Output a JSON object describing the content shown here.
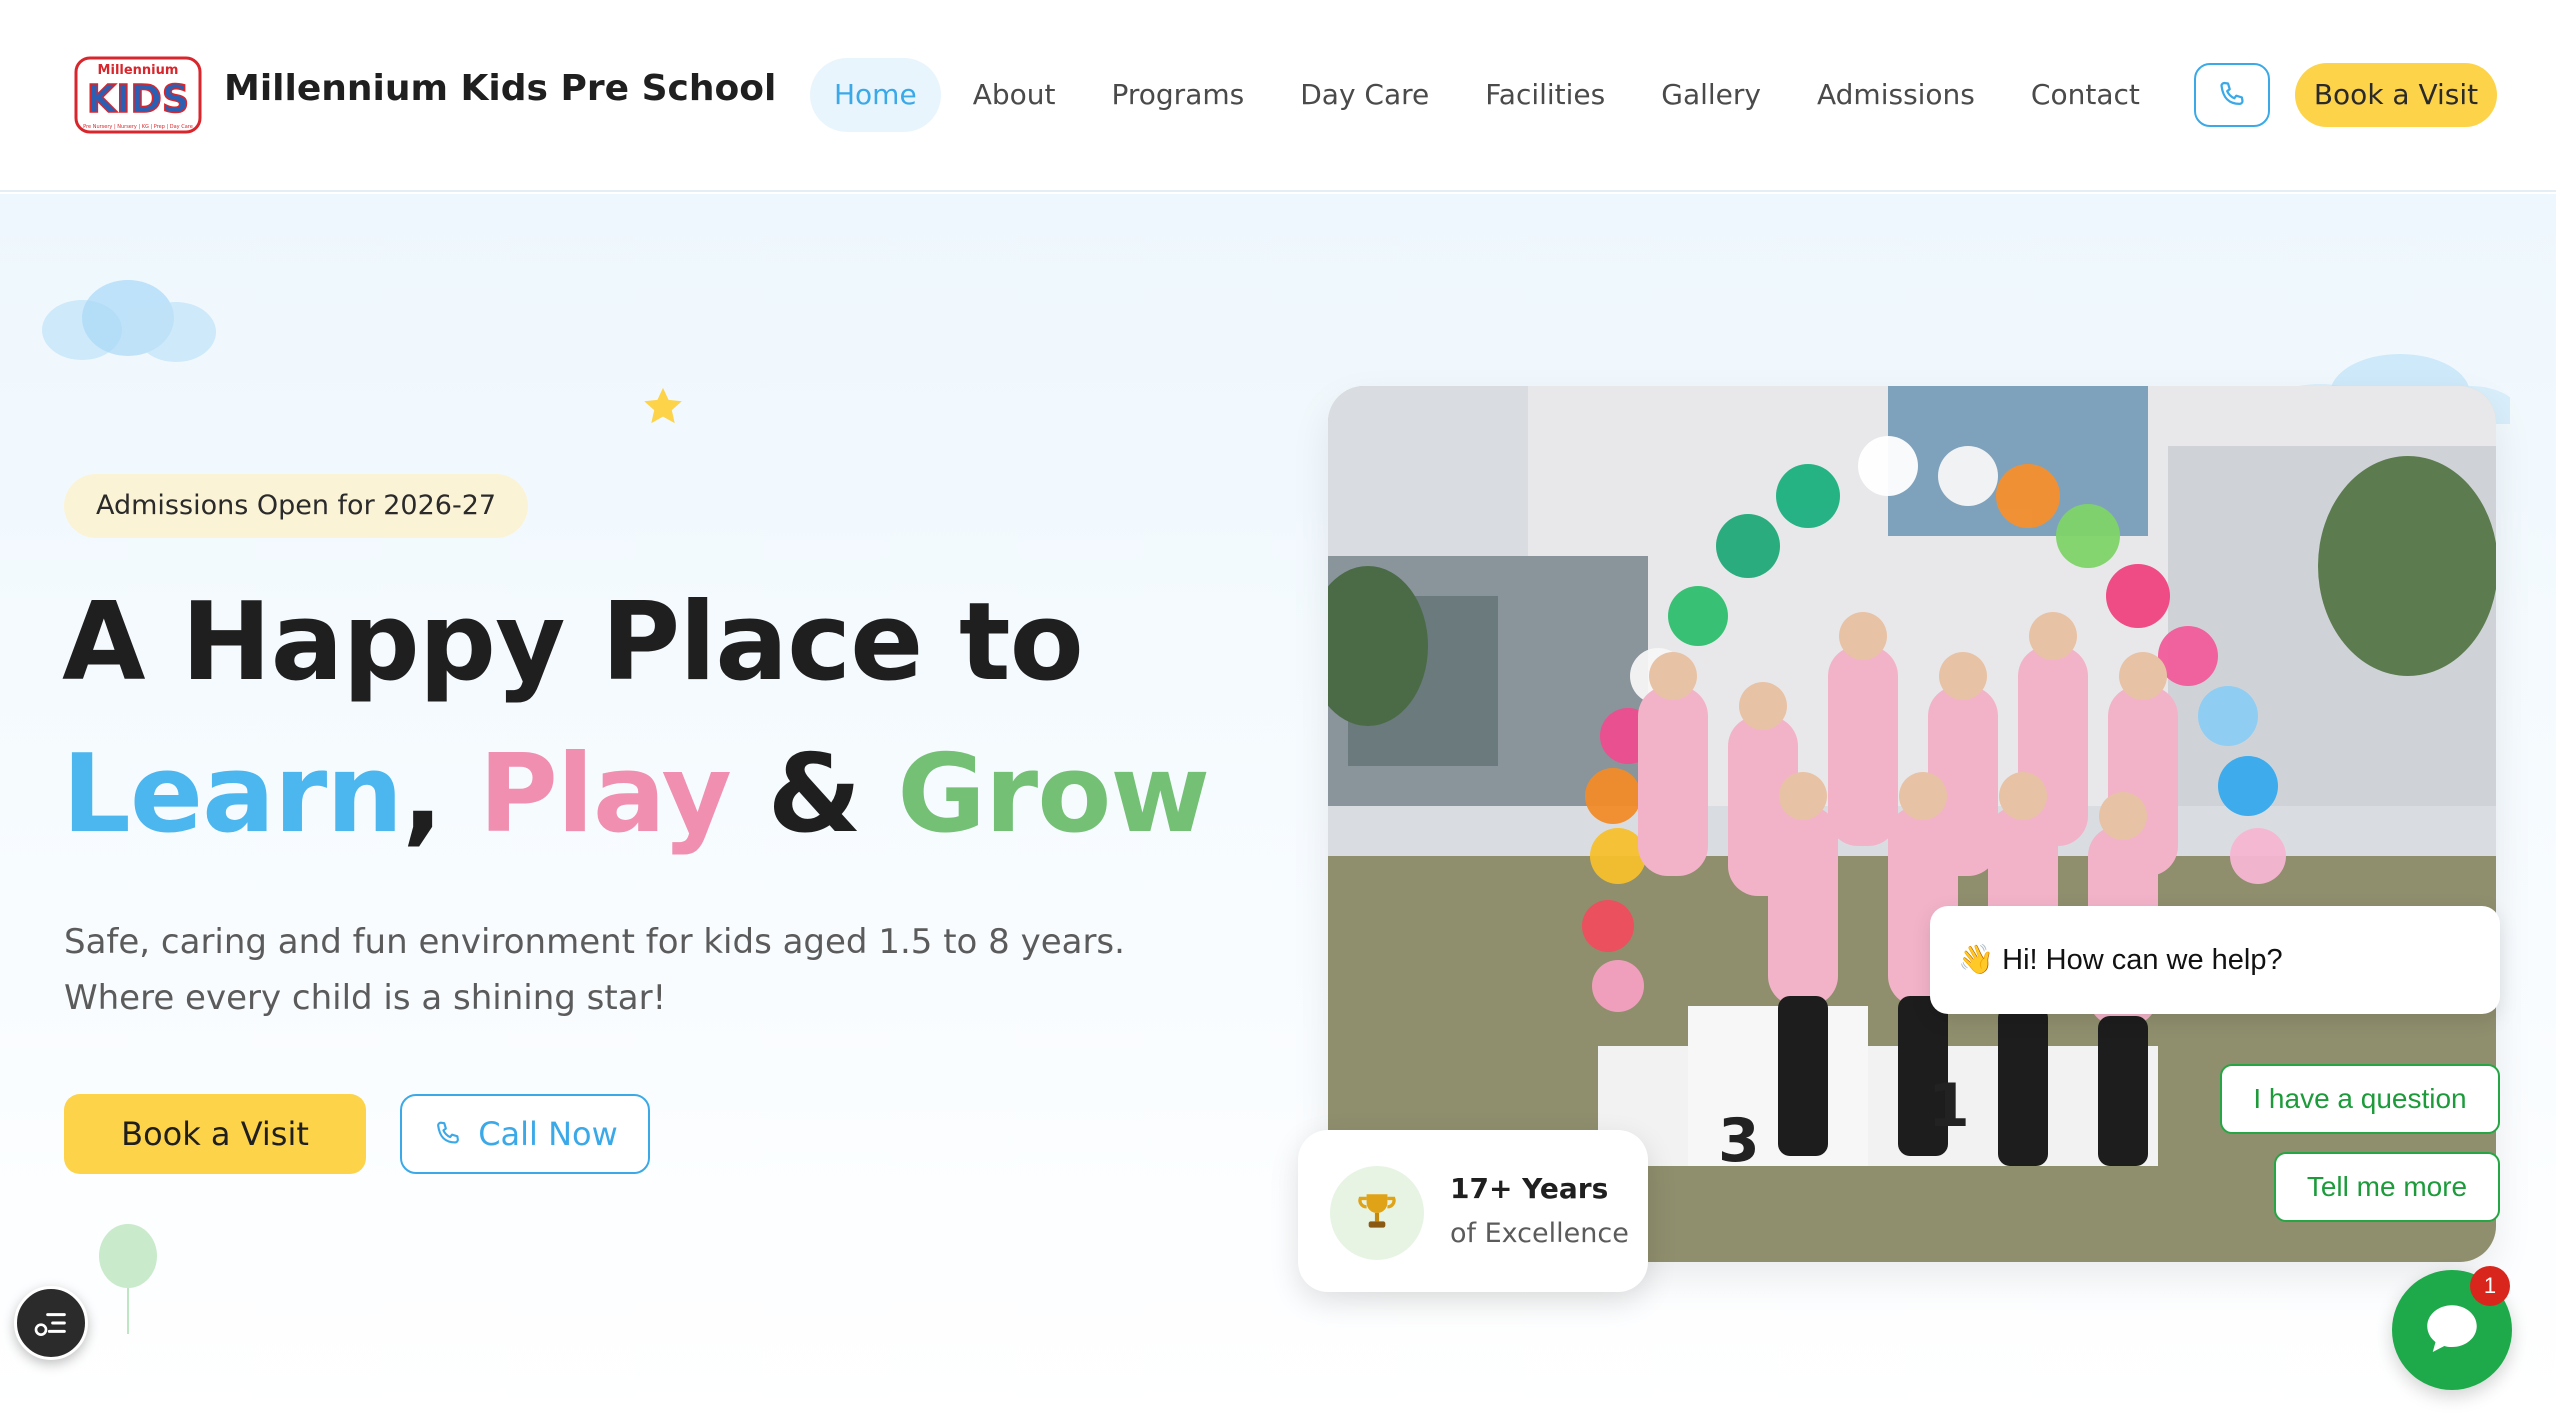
{
  "brand": {
    "logo_top": "Millennium",
    "logo_main": "KIDS",
    "logo_tagline": "Pre Nursery | Nursery | KG | Prep | Day Care",
    "name": "Millennium Kids Pre School"
  },
  "nav": {
    "items": [
      {
        "label": "Home",
        "active": true
      },
      {
        "label": "About"
      },
      {
        "label": "Programs"
      },
      {
        "label": "Day Care"
      },
      {
        "label": "Facilities"
      },
      {
        "label": "Gallery"
      },
      {
        "label": "Admissions"
      },
      {
        "label": "Contact"
      }
    ],
    "book_label": "Book a Visit",
    "phone_icon": "phone-icon"
  },
  "hero": {
    "badge": "Admissions Open for 2026-27",
    "headline_line1": "A Happy Place to",
    "word_learn": "Learn",
    "comma": ",",
    "word_play": "Play",
    "amp": "&",
    "word_grow": "Grow",
    "subtitle": "Safe, caring and fun environment for kids aged 1.5 to 8 years. Where every child is a shining star!",
    "cta_book": "Book a Visit",
    "cta_call": "Call Now"
  },
  "excellence": {
    "title": "17+ Years",
    "subtitle": "of Excellence",
    "icon": "trophy-icon"
  },
  "chat": {
    "greeting": "👋 Hi! How can we help?",
    "option1": "I have a question",
    "option2": "Tell me more",
    "unread_count": "1"
  },
  "colors": {
    "accent_blue": "#3ba9e8",
    "accent_yellow": "#fdd34a",
    "learn": "#4cb6ef",
    "play": "#f08fb0",
    "grow": "#74c176",
    "chat_green": "#1eaa4a"
  }
}
